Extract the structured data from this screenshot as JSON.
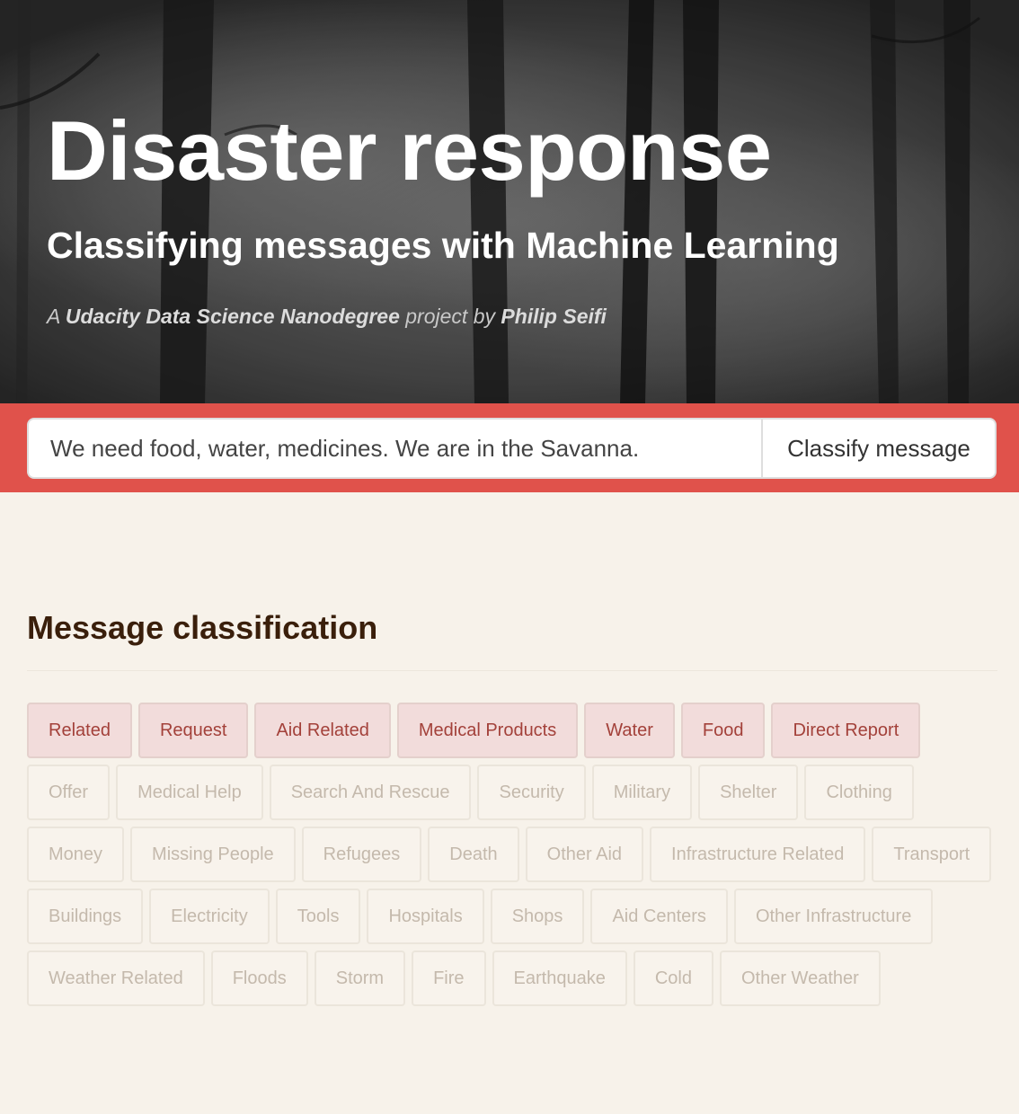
{
  "header": {
    "title": "Disaster response",
    "subtitle": "Classifying messages with Machine Learning",
    "credit_prefix": "A ",
    "credit_program": "Udacity Data Science Nanodegree",
    "credit_middle": " project by ",
    "credit_author": "Philip Seifi"
  },
  "search": {
    "value": "We need food, water, medicines. We are in the Savanna.",
    "button_label": "Classify message"
  },
  "results": {
    "title": "Message classification",
    "categories": [
      {
        "label": "Related",
        "active": true
      },
      {
        "label": "Request",
        "active": true
      },
      {
        "label": "Aid Related",
        "active": true
      },
      {
        "label": "Medical Products",
        "active": true
      },
      {
        "label": "Water",
        "active": true
      },
      {
        "label": "Food",
        "active": true
      },
      {
        "label": "Direct Report",
        "active": true
      },
      {
        "label": "Offer",
        "active": false
      },
      {
        "label": "Medical Help",
        "active": false
      },
      {
        "label": "Search And Rescue",
        "active": false
      },
      {
        "label": "Security",
        "active": false
      },
      {
        "label": "Military",
        "active": false
      },
      {
        "label": "Shelter",
        "active": false
      },
      {
        "label": "Clothing",
        "active": false
      },
      {
        "label": "Money",
        "active": false
      },
      {
        "label": "Missing People",
        "active": false
      },
      {
        "label": "Refugees",
        "active": false
      },
      {
        "label": "Death",
        "active": false
      },
      {
        "label": "Other Aid",
        "active": false
      },
      {
        "label": "Infrastructure Related",
        "active": false
      },
      {
        "label": "Transport",
        "active": false
      },
      {
        "label": "Buildings",
        "active": false
      },
      {
        "label": "Electricity",
        "active": false
      },
      {
        "label": "Tools",
        "active": false
      },
      {
        "label": "Hospitals",
        "active": false
      },
      {
        "label": "Shops",
        "active": false
      },
      {
        "label": "Aid Centers",
        "active": false
      },
      {
        "label": "Other Infrastructure",
        "active": false
      },
      {
        "label": "Weather Related",
        "active": false
      },
      {
        "label": "Floods",
        "active": false
      },
      {
        "label": "Storm",
        "active": false
      },
      {
        "label": "Fire",
        "active": false
      },
      {
        "label": "Earthquake",
        "active": false
      },
      {
        "label": "Cold",
        "active": false
      },
      {
        "label": "Other Weather",
        "active": false
      }
    ]
  },
  "colors": {
    "accent": "#e0524b",
    "page_background": "#f7f2ea",
    "active_tag_background": "#f2dcdb",
    "active_tag_text": "#a3413a",
    "inactive_tag_text": "#c4b9ac",
    "section_title": "#3a1f0b"
  }
}
